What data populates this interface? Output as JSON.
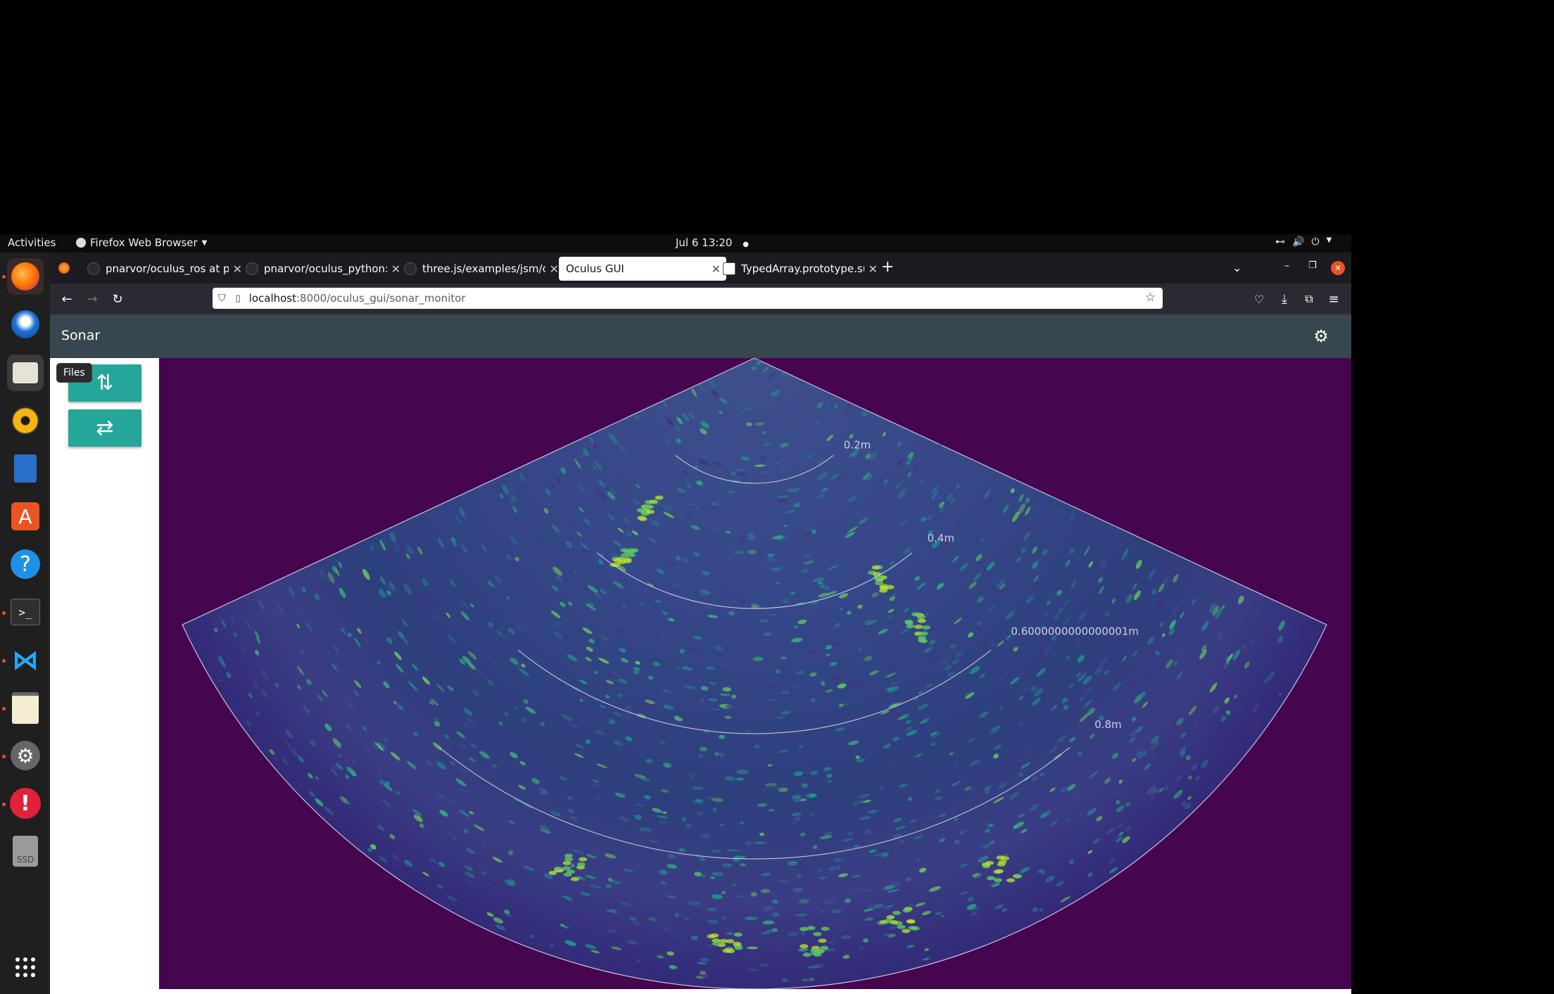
{
  "topbar": {
    "activities": "Activities",
    "app_menu": "Firefox Web Browser",
    "clock": "Jul 6  13:20"
  },
  "dock": {
    "tooltip": "Files",
    "icons": [
      "firefox-icon",
      "thunderbird-icon",
      "files-icon",
      "rhythmbox-icon",
      "writer-icon",
      "app-center-icon",
      "help-icon",
      "terminal-icon",
      "vscode-icon",
      "text-editor-icon",
      "settings-icon",
      "error-report-icon",
      "ssd-drive-icon",
      "show-apps-icon"
    ],
    "ssd_label": "SSD"
  },
  "browser": {
    "tabs": [
      {
        "label": "pnarvor/oculus_ros at pn",
        "active": false
      },
      {
        "label": "pnarvor/oculus_python: I",
        "active": false
      },
      {
        "label": "three.js/examples/jsm/co",
        "active": false
      },
      {
        "label": "Oculus GUI",
        "active": true
      },
      {
        "label": "TypedArray.prototype.su",
        "active": false
      }
    ],
    "url_host": "localhost",
    "url_path": ":8000/oculus_gui/sonar_monitor"
  },
  "app": {
    "title": "Sonar",
    "colors": {
      "appbar": "#37474f",
      "button": "#26a69a",
      "sonar_bg": "#45064f"
    }
  },
  "sonar": {
    "range_labels": [
      "0.2m",
      "0.4m",
      "0.6000000000000001m",
      "0.8m"
    ]
  }
}
